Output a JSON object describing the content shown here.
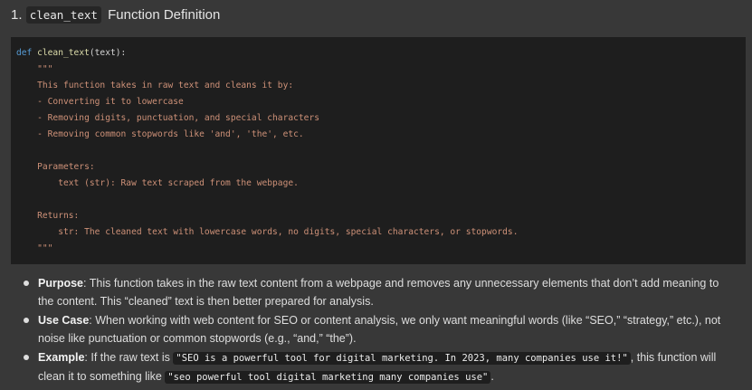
{
  "heading": {
    "number": "1.",
    "code": "clean_text",
    "title": "Function Definition"
  },
  "code_block": {
    "keyword": "def",
    "function_name": "clean_text",
    "signature_rest": "(text):",
    "docstring_lines": [
      "    \"\"\"",
      "    This function takes in raw text and cleans it by:",
      "    - Converting it to lowercase",
      "    - Removing digits, punctuation, and special characters",
      "    - Removing common stopwords like 'and', 'the', etc.",
      "",
      "    Parameters:",
      "        text (str): Raw text scraped from the webpage.",
      "",
      "    Returns:",
      "        str: The cleaned text with lowercase words, no digits, special characters, or stopwords.",
      "    \"\"\""
    ]
  },
  "bullets": [
    {
      "label": "Purpose",
      "text": ": This function takes in the raw text content from a webpage and removes any unnecessary elements that don’t add meaning to the content. This “cleaned” text is then better prepared for analysis."
    },
    {
      "label": "Use Case",
      "text": ": When working with web content for SEO or content analysis, we only want meaningful words (like “SEO,” “strategy,” etc.), not noise like punctuation or common stopwords (e.g., “and,” “the”)."
    },
    {
      "label": "Example",
      "text_before": ": If the raw text is ",
      "code_raw": "\"SEO is a powerful tool for digital marketing. In 2023, many companies use it!\"",
      "text_middle": ", this function will clean it to something like ",
      "code_clean": "\"seo powerful tool digital marketing many companies use\"",
      "text_after": "."
    }
  ]
}
